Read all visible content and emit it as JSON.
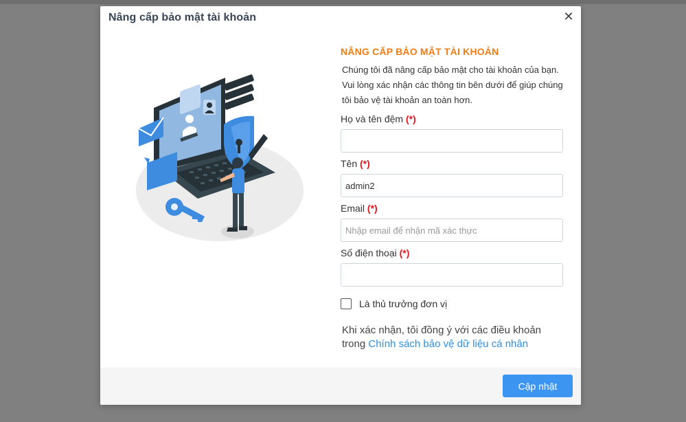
{
  "modal": {
    "title": "Nâng cấp bảo mật tài khoản",
    "close_label": "✕"
  },
  "form": {
    "heading": "NÂNG CẤP BẢO MẬT TÀI KHOẢN",
    "intro": "Chúng tôi đã nâng cấp bảo mật cho tài khoản của bạn. Vui lòng xác nhận các thông tin bên dưới để giúp chúng tôi bảo vệ tài khoản an toàn hơn.",
    "required_marker": "(*)",
    "fields": [
      {
        "label": "Họ và tên đệm",
        "value": "",
        "placeholder": ""
      },
      {
        "label": "Tên",
        "value": "admin2",
        "placeholder": ""
      },
      {
        "label": "Email",
        "value": "",
        "placeholder": "Nhập email để nhận mã xác thực"
      },
      {
        "label": "Số điện thoại",
        "value": "",
        "placeholder": ""
      }
    ],
    "checkbox": {
      "label": "Là thủ trưởng đơn vị",
      "checked": false
    },
    "consent_text": "Khi xác nhận, tôi đồng ý với các điều khoản trong",
    "consent_link": "Chính sách bảo vệ dữ liệu cá nhân"
  },
  "footer": {
    "submit_label": "Cập nhật"
  },
  "colors": {
    "heading_accent": "#f07c13",
    "required": "#e4151b",
    "link": "#2f8fe3",
    "primary_button": "#3d95f2",
    "overlay": "#808080"
  },
  "icons": [
    "close-icon",
    "security-illustration",
    "checkbox-icon"
  ]
}
